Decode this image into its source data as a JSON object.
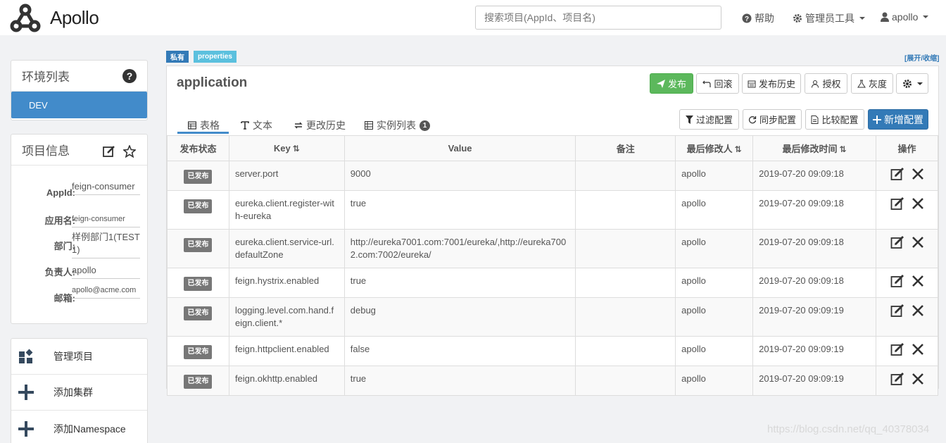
{
  "nav": {
    "brand": "Apollo",
    "search_placeholder": "搜索项目(AppId、项目名)",
    "help": "帮助",
    "admin_tools": "管理员工具",
    "user": "apollo"
  },
  "env_panel": {
    "title": "环境列表",
    "envs": [
      "DEV"
    ]
  },
  "project_panel": {
    "title": "项目信息",
    "fields": [
      {
        "label": "AppId:",
        "value": "feign-consumer"
      },
      {
        "label": "应用名:",
        "value": "feign-consumer"
      },
      {
        "label": "部门:",
        "value": "样例部门1(TEST1)"
      },
      {
        "label": "负责人:",
        "value": "apollo"
      },
      {
        "label": "邮箱:",
        "value": "apollo@acme.com"
      }
    ]
  },
  "menu": [
    {
      "label": "管理项目",
      "icon": "widgets-icon"
    },
    {
      "label": "添加集群",
      "icon": "plus-icon"
    },
    {
      "label": "添加Namespace",
      "icon": "plus-icon"
    }
  ],
  "namespace": {
    "tag_private": "私有",
    "tag_format": "properties",
    "expand_toggle": "[展开/收缩]",
    "name": "application",
    "buttons": {
      "publish": "发布",
      "rollback": "回滚",
      "history": "发布历史",
      "authorize": "授权",
      "gray": "灰度"
    },
    "tabs": {
      "table": "表格",
      "text": "文本",
      "changes": "更改历史",
      "instances": "实例列表",
      "instance_count": "1"
    },
    "actions": {
      "filter": "过滤配置",
      "sync": "同步配置",
      "compare": "比较配置",
      "add": "新增配置"
    },
    "columns": [
      "发布状态",
      "Key",
      "Value",
      "备注",
      "最后修改人",
      "最后修改时间",
      "操作"
    ],
    "rows": [
      {
        "status": "已发布",
        "key": "server.port",
        "value": "9000",
        "comment": "",
        "modifier": "apollo",
        "time": "2019-07-20 09:09:18"
      },
      {
        "status": "已发布",
        "key": "eureka.client.register-with-eureka",
        "value": "true",
        "comment": "",
        "modifier": "apollo",
        "time": "2019-07-20 09:09:18"
      },
      {
        "status": "已发布",
        "key": "eureka.client.service-url.defaultZone",
        "value": "http://eureka7001.com:7001/eureka/,http://eureka7002.com:7002/eureka/",
        "comment": "",
        "modifier": "apollo",
        "time": "2019-07-20 09:09:18"
      },
      {
        "status": "已发布",
        "key": "feign.hystrix.enabled",
        "value": "true",
        "comment": "",
        "modifier": "apollo",
        "time": "2019-07-20 09:09:18"
      },
      {
        "status": "已发布",
        "key": "logging.level.com.hand.feign.client.*",
        "value": "debug",
        "comment": "",
        "modifier": "apollo",
        "time": "2019-07-20 09:09:19"
      },
      {
        "status": "已发布",
        "key": "feign.httpclient.enabled",
        "value": "false",
        "comment": "",
        "modifier": "apollo",
        "time": "2019-07-20 09:09:19"
      },
      {
        "status": "已发布",
        "key": "feign.okhttp.enabled",
        "value": "true",
        "comment": "",
        "modifier": "apollo",
        "time": "2019-07-20 09:09:19"
      }
    ]
  },
  "watermark": "https://blog.csdn.net/qq_40378034",
  "colors": {
    "primary": "#428bca",
    "success": "#5cb85c",
    "info_tag": "#5bc0de",
    "private_tag": "#337ab7",
    "published_badge": "#777777"
  }
}
